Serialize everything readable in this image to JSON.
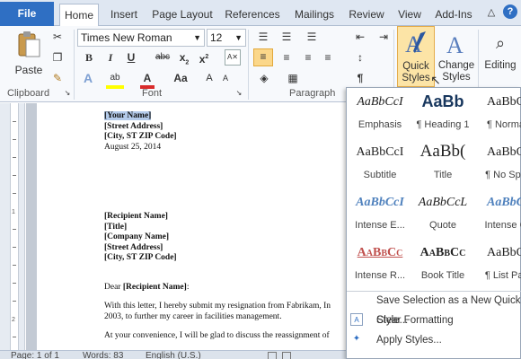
{
  "tabs": {
    "file": "File",
    "home": "Home",
    "insert": "Insert",
    "page_layout": "Page Layout",
    "references": "References",
    "mailings": "Mailings",
    "review": "Review",
    "view": "View",
    "addins": "Add-Ins"
  },
  "groups": {
    "clipboard": "Clipboard",
    "font": "Font",
    "paragraph": "Paragraph"
  },
  "clipboard": {
    "paste": "Paste"
  },
  "font": {
    "name": "Times New Roman",
    "size": "12",
    "underline": "U",
    "strike": "abc",
    "sub": "x",
    "sup": "x",
    "font_color": "A",
    "change_case": "Aa"
  },
  "styles_group": {
    "quick_styles": [
      "Quick",
      "Styles"
    ],
    "change_styles": [
      "Change",
      "Styles"
    ],
    "editing": "Editing"
  },
  "document": {
    "your_name": "[Your Name]",
    "street": "[Street Address]",
    "city": "[City, ST  ZIP Code]",
    "date": "August 25, 2014",
    "recipient_name": "[Recipient Name]",
    "title": "[Title]",
    "company": "[Company Name]",
    "street2": "[Street Address]",
    "city2": "[City, ST  ZIP Code]",
    "dear_prefix": "Dear ",
    "dear_name": "[Recipient Name]",
    "dear_suffix": ":",
    "para1_line1": "With this letter, I hereby submit my resignation from Fabrikam, In",
    "para1_line2": "2003, to further my career in facilities management.",
    "para2_line1": "At your convenience, I will be glad to discuss the reassignment of"
  },
  "gallery": {
    "styles": [
      {
        "sample": "AaBbCcI",
        "name": "Emphasis"
      },
      {
        "sample": "AaBb",
        "name": "¶ Heading 1"
      },
      {
        "sample": "AaBbC",
        "name": "¶ Norma"
      },
      {
        "sample": "AaBbCcI",
        "name": "Subtitle"
      },
      {
        "sample": "AaBb(",
        "name": "Title"
      },
      {
        "sample": "AaBbC",
        "name": "¶ No Spa"
      },
      {
        "sample": "AaBbCcI",
        "name": "Intense E..."
      },
      {
        "sample": "AaBbCcL",
        "name": "Quote"
      },
      {
        "sample": "AaBbC",
        "name": "Intense C"
      },
      {
        "sample": "AaBbCc",
        "name": "Intense R..."
      },
      {
        "sample": "AaBbCc",
        "name": "Book Title"
      },
      {
        "sample": "AaBbC",
        "name": "¶ List Par"
      }
    ],
    "commands": {
      "save": "Save Selection as a New Quick Style...",
      "clear": "Clear Formatting",
      "apply": "Apply Styles..."
    }
  },
  "statusbar": {
    "page": "Page: 1 of 1",
    "words": "Words: 83",
    "language": "English (U.S.)"
  },
  "colors": {
    "file_tab": "#2f6fc3",
    "selected_style": "#fbe4a4",
    "highlight": "#ffff00",
    "font_red": "#d92b2b",
    "selection": "#b4cbea"
  }
}
